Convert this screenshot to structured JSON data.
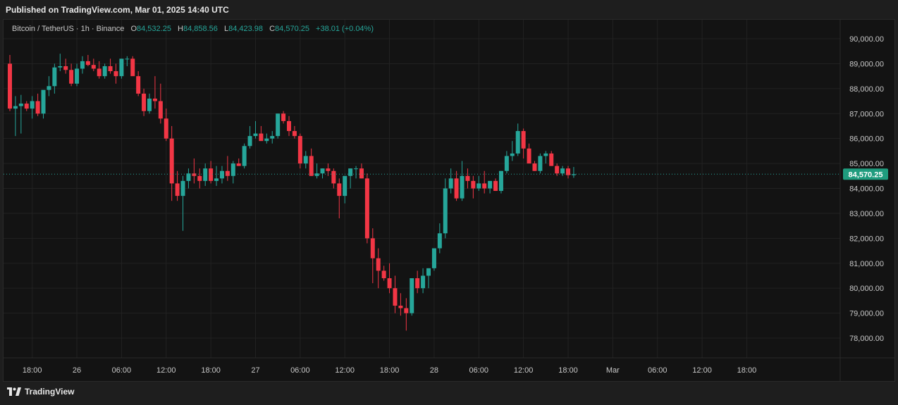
{
  "header": {
    "published_text": "Published on TradingView.com, Mar 01, 2025 14:40 UTC"
  },
  "info": {
    "symbol": "Bitcoin / TetherUS · 1h · Binance",
    "open_label": "O",
    "open_value": "84,532.25",
    "high_label": "H",
    "high_value": "84,858.56",
    "low_label": "L",
    "low_value": "84,423.98",
    "close_label": "C",
    "close_value": "84,570.25",
    "change": "+38.01 (+0.04%)"
  },
  "footer": {
    "brand": "TradingView"
  },
  "colors": {
    "up": "#26a69a",
    "down": "#f23645",
    "background": "#131313",
    "grid": "#222222",
    "price_tag": "#1f9c7e"
  },
  "chart_data": {
    "type": "candlestick",
    "title": "Bitcoin / TetherUS · 1h · Binance",
    "last_price": 84570.25,
    "last_price_label": "84,570.25",
    "ylim": [
      77500,
      90500
    ],
    "y_ticks": [
      "90,000.00",
      "89,000.00",
      "88,000.00",
      "87,000.00",
      "86,000.00",
      "85,000.00",
      "84,000.00",
      "83,000.00",
      "82,000.00",
      "81,000.00",
      "80,000.00",
      "79,000.00",
      "78,000.00"
    ],
    "y_tick_values": [
      90000,
      89000,
      88000,
      87000,
      86000,
      85000,
      84000,
      83000,
      82000,
      81000,
      80000,
      79000,
      78000
    ],
    "x_ticks": [
      "18:00",
      "26",
      "06:00",
      "12:00",
      "18:00",
      "27",
      "06:00",
      "12:00",
      "18:00",
      "28",
      "06:00",
      "12:00",
      "18:00",
      "Mar",
      "06:00",
      "12:00",
      "18:00"
    ],
    "x_tick_candle_index": [
      4,
      12,
      20,
      28,
      36,
      44,
      52,
      60,
      68,
      76,
      84,
      92,
      100,
      108,
      116,
      124,
      132
    ],
    "grid": true,
    "candles": [
      [
        89000,
        89350,
        87100,
        87200
      ],
      [
        87200,
        87700,
        86100,
        87300
      ],
      [
        87300,
        87750,
        86200,
        87400
      ],
      [
        87400,
        87500,
        87100,
        87200
      ],
      [
        87200,
        87700,
        86800,
        87500
      ],
      [
        87500,
        87800,
        86900,
        87000
      ],
      [
        87000,
        87900,
        86800,
        87950
      ],
      [
        87950,
        88500,
        87700,
        88100
      ],
      [
        88100,
        89000,
        87800,
        88850
      ],
      [
        88850,
        89400,
        88700,
        88900
      ],
      [
        88900,
        89200,
        88600,
        88750
      ],
      [
        88750,
        89000,
        88100,
        88200
      ],
      [
        88200,
        89000,
        88100,
        88800
      ],
      [
        88800,
        89300,
        88600,
        89100
      ],
      [
        89100,
        89350,
        88900,
        88950
      ],
      [
        88950,
        89200,
        88700,
        88800
      ],
      [
        88800,
        89100,
        88400,
        88500
      ],
      [
        88500,
        89000,
        88400,
        88900
      ],
      [
        88900,
        89200,
        88600,
        88700
      ],
      [
        88700,
        89000,
        88200,
        88500
      ],
      [
        88500,
        89200,
        88400,
        89200
      ],
      [
        89200,
        89300,
        88900,
        89200
      ],
      [
        89200,
        89300,
        88800,
        88500
      ],
      [
        88500,
        88700,
        87700,
        87800
      ],
      [
        87800,
        88000,
        86900,
        87100
      ],
      [
        87100,
        87800,
        87000,
        87600
      ],
      [
        87600,
        88500,
        87200,
        87500
      ],
      [
        87500,
        88200,
        86600,
        86800
      ],
      [
        86800,
        87200,
        85900,
        86000
      ],
      [
        86000,
        86500,
        83500,
        84200
      ],
      [
        84200,
        84700,
        83500,
        83700
      ],
      [
        83700,
        84500,
        82300,
        84300
      ],
      [
        84300,
        84800,
        84000,
        84600
      ],
      [
        84600,
        85200,
        84200,
        84500
      ],
      [
        84500,
        84800,
        84000,
        84300
      ],
      [
        84300,
        85000,
        84100,
        84800
      ],
      [
        84800,
        85100,
        84200,
        84300
      ],
      [
        84300,
        84900,
        84100,
        84400
      ],
      [
        84400,
        84900,
        84200,
        84700
      ],
      [
        84700,
        85300,
        84300,
        84500
      ],
      [
        84500,
        85100,
        84200,
        85000
      ],
      [
        85000,
        85200,
        84900,
        84900
      ],
      [
        84900,
        85800,
        84800,
        85700
      ],
      [
        85700,
        86500,
        85600,
        86100
      ],
      [
        86100,
        86700,
        86000,
        86200
      ],
      [
        86200,
        86500,
        86000,
        85900
      ],
      [
        85900,
        86200,
        85800,
        86000
      ],
      [
        86000,
        86300,
        85800,
        86100
      ],
      [
        86100,
        87000,
        86000,
        87000
      ],
      [
        87000,
        87100,
        86600,
        86700
      ],
      [
        86700,
        86900,
        86100,
        86300
      ],
      [
        86300,
        86500,
        86000,
        86100
      ],
      [
        86100,
        86200,
        84800,
        85000
      ],
      [
        85000,
        85500,
        84800,
        85300
      ],
      [
        85300,
        85600,
        84500,
        84500
      ],
      [
        84500,
        85000,
        84400,
        84600
      ],
      [
        84600,
        84800,
        84400,
        84800
      ],
      [
        84800,
        85000,
        84500,
        84700
      ],
      [
        84700,
        84800,
        84000,
        84200
      ],
      [
        84200,
        84400,
        82800,
        83700
      ],
      [
        83700,
        84500,
        83400,
        84500
      ],
      [
        84500,
        84800,
        84000,
        84800
      ],
      [
        84800,
        84900,
        84400,
        84800
      ],
      [
        84800,
        85000,
        84400,
        84400
      ],
      [
        84400,
        84600,
        81800,
        82000
      ],
      [
        82000,
        82400,
        80200,
        81200
      ],
      [
        81200,
        81600,
        80000,
        80700
      ],
      [
        80700,
        80900,
        80300,
        80400
      ],
      [
        80400,
        81000,
        79800,
        80000
      ],
      [
        80000,
        80500,
        79000,
        79300
      ],
      [
        79300,
        79800,
        78900,
        79200
      ],
      [
        79200,
        79600,
        78300,
        79000
      ],
      [
        79000,
        80400,
        78900,
        80400
      ],
      [
        80400,
        80700,
        79800,
        80000
      ],
      [
        80000,
        80800,
        79800,
        80500
      ],
      [
        80500,
        80800,
        80000,
        80800
      ],
      [
        80800,
        81600,
        80700,
        81600
      ],
      [
        81600,
        82600,
        81400,
        82200
      ],
      [
        82200,
        84400,
        82000,
        84000
      ],
      [
        84000,
        84800,
        83800,
        84400
      ],
      [
        84400,
        84700,
        83500,
        83600
      ],
      [
        83600,
        85100,
        83500,
        84500
      ],
      [
        84500,
        84800,
        84000,
        84300
      ],
      [
        84300,
        84500,
        83600,
        84000
      ],
      [
        84000,
        84500,
        83900,
        84200
      ],
      [
        84200,
        84700,
        83800,
        84000
      ],
      [
        84000,
        84200,
        83800,
        84300
      ],
      [
        84300,
        84400,
        83900,
        83900
      ],
      [
        83900,
        84700,
        83800,
        84700
      ],
      [
        84700,
        85500,
        84600,
        85300
      ],
      [
        85300,
        85900,
        85100,
        85400
      ],
      [
        85400,
        86600,
        85300,
        86300
      ],
      [
        86300,
        86400,
        85200,
        85600
      ],
      [
        85600,
        85800,
        85000,
        85000
      ],
      [
        85000,
        85100,
        84700,
        84700
      ],
      [
        84700,
        85400,
        84600,
        85300
      ],
      [
        85300,
        85500,
        85000,
        85400
      ],
      [
        85400,
        85500,
        84900,
        84900
      ],
      [
        84900,
        85000,
        84500,
        84600
      ],
      [
        84600,
        84900,
        84500,
        84800
      ],
      [
        84800,
        84900,
        84400,
        84532
      ],
      [
        84532,
        84859,
        84424,
        84570
      ]
    ]
  }
}
